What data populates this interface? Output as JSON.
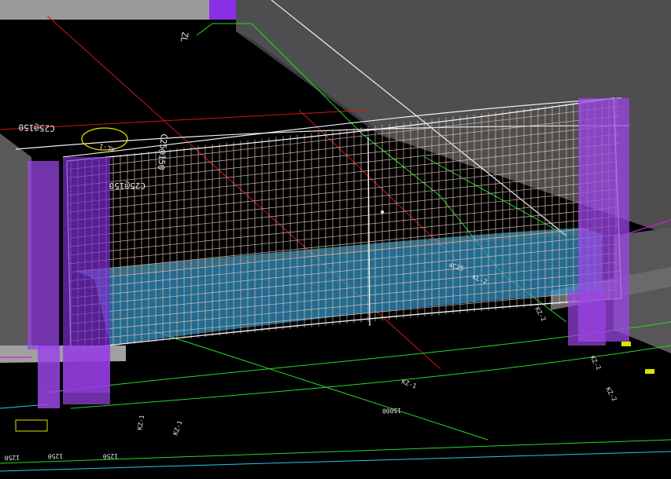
{
  "colors": {
    "background": "#000000",
    "slab": "#4f4f4f",
    "slab_dark": "#3a3a3a",
    "column": "#9b45e6",
    "beam": "#2f8fc0",
    "rebar": "#e8c9b8",
    "grid_line_red": "#d01818",
    "grid_line_green": "#28d828",
    "outline_white": "#f0f0f0",
    "cyan": "#28c8e0",
    "yellow": "#e0e000",
    "magenta": "#d020d0"
  },
  "labels": {
    "top_tag": "ZL",
    "rebar_a": "C25@150",
    "rebar_b": "C25@150",
    "beam_tag": "KL-1",
    "beam_spec": "C25@150",
    "dim_main": "15000",
    "dim_a": "1250",
    "dim_b": "1250",
    "dim_c": "1250",
    "tag_bottom_a": "KZ-1",
    "tag_bottom_b": "KZ-1",
    "tag_bottom_c": "KZ-1",
    "tag_right_a": "KZ-2",
    "tag_right_b": "KZ-2",
    "tag_right_c": "KZ-2",
    "tag_mid": "KL-2",
    "tag_beam_center": "4C25"
  }
}
